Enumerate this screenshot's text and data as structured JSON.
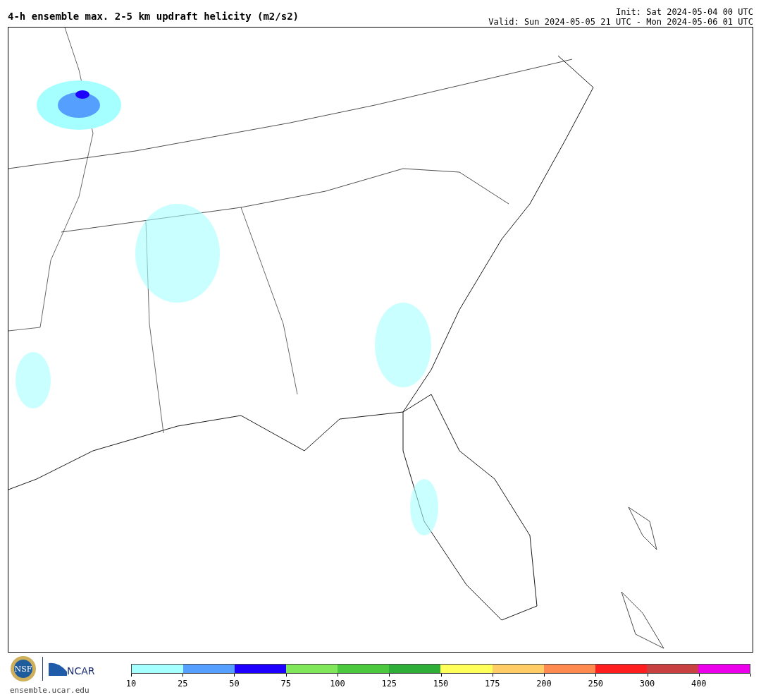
{
  "title": "4-h ensemble max. 2-5 km updraft helicity (m2/s2)",
  "init": "Init: Sat 2024-05-04 00 UTC",
  "valid": "Valid: Sun 2024-05-05 21 UTC - Mon 2024-05-06 01 UTC",
  "logos": {
    "nsf": "NSF",
    "ncar": "NCAR",
    "url": "ensemble.ucar.edu"
  },
  "colorbar": {
    "segments": [
      {
        "color": "#a6ffff"
      },
      {
        "color": "#55a0ff"
      },
      {
        "color": "#1e00ff"
      },
      {
        "color": "#80e65a"
      },
      {
        "color": "#4cc83f"
      },
      {
        "color": "#2fae37"
      },
      {
        "color": "#ffff5a"
      },
      {
        "color": "#ffcc66"
      },
      {
        "color": "#ff8a50"
      },
      {
        "color": "#ff1e1e"
      },
      {
        "color": "#c84040"
      },
      {
        "color": "#ec00ec"
      }
    ],
    "ticks": [
      "10",
      "25",
      "50",
      "75",
      "100",
      "125",
      "150",
      "175",
      "200",
      "250",
      "300",
      "400"
    ]
  }
}
